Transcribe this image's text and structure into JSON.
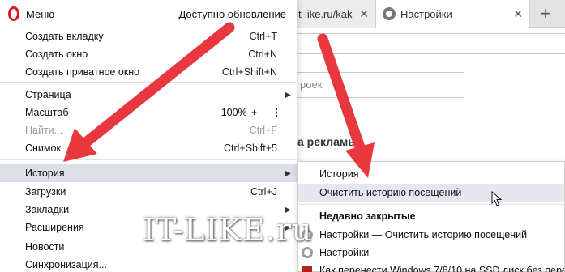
{
  "browser": {
    "tab1_title": "t-like.ru/kak-",
    "tab2_title": "Настройки",
    "search_placeholder": "роек",
    "ads_heading": "а рекламы"
  },
  "menu": {
    "title": "Меню",
    "update_label": "Доступно обновление",
    "items": [
      {
        "label": "Создать вкладку",
        "shortcut": "Ctrl+T"
      },
      {
        "label": "Создать окно",
        "shortcut": "Ctrl+N"
      },
      {
        "label": "Создать приватное окно",
        "shortcut": "Ctrl+Shift+N"
      },
      {
        "label": "Страница",
        "shortcut": ""
      },
      {
        "label": "Масштаб",
        "shortcut": ""
      },
      {
        "label": "Найти...",
        "shortcut": "Ctrl+F"
      },
      {
        "label": "Снимок",
        "shortcut": "Ctrl+Shift+5"
      },
      {
        "label": "История",
        "shortcut": ""
      },
      {
        "label": "Загрузки",
        "shortcut": "Ctrl+J"
      },
      {
        "label": "Закладки",
        "shortcut": ""
      },
      {
        "label": "Расширения",
        "shortcut": ""
      },
      {
        "label": "Новости",
        "shortcut": ""
      },
      {
        "label": "Синхронизация...",
        "shortcut": ""
      }
    ],
    "zoom": {
      "minus": "—",
      "value": "100%",
      "plus": "+"
    }
  },
  "submenu": {
    "items": [
      {
        "label": "История"
      },
      {
        "label": "Очистить историю посещений"
      },
      {
        "label": "Недавно закрытые"
      },
      {
        "label": "Настройки — Очистить историю посещений"
      },
      {
        "label": "Настройки"
      },
      {
        "label": "Как перенести Windows 7/8/10 на SSD диск без переуст"
      }
    ]
  },
  "watermark": "IT-LIKE.ru",
  "colors": {
    "accent_red": "#e8383d",
    "opera_red": "#e0131e",
    "highlight": "#dcdfe6"
  }
}
